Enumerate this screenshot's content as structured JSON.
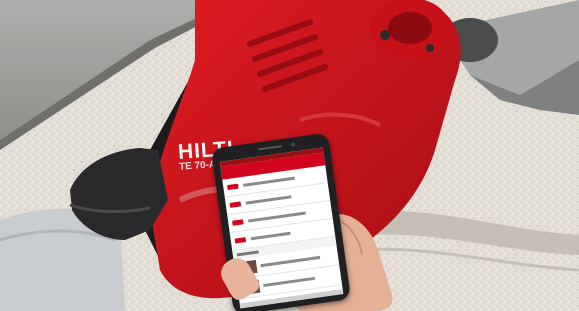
{
  "photo": {
    "brand": "HILTI",
    "model": "TE 70-ATC"
  }
}
